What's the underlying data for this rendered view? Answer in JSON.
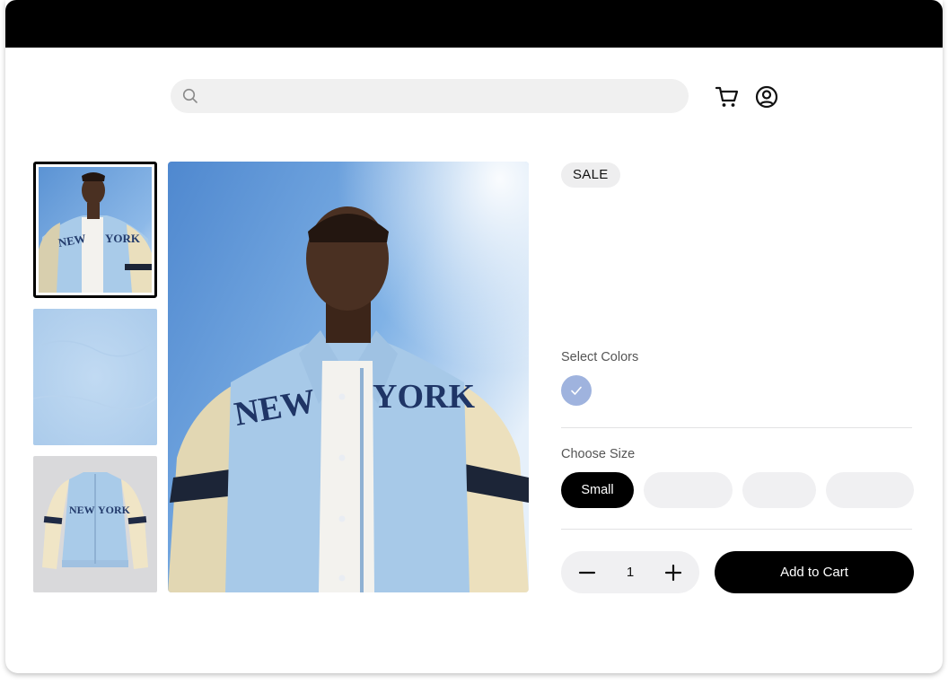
{
  "header": {
    "search": {
      "placeholder": ""
    },
    "icons": [
      "search-icon",
      "cart-icon",
      "account-icon"
    ]
  },
  "gallery": {
    "thumbnails": [
      {
        "name": "model-wearing-jacket",
        "selected": true
      },
      {
        "name": "fabric-texture",
        "selected": false
      },
      {
        "name": "jacket-flat",
        "selected": false
      }
    ],
    "jacket_lettering_left": "NEW",
    "jacket_lettering_right": "YORK"
  },
  "product": {
    "badge": "SALE",
    "colors_label": "Select Colors",
    "colors": [
      {
        "hex": "#9fb3de",
        "selected": true
      }
    ],
    "size_label": "Choose Size",
    "sizes": [
      {
        "label": "Small",
        "selected": true
      },
      {
        "label": "",
        "selected": false
      },
      {
        "label": "",
        "selected": false
      },
      {
        "label": "",
        "selected": false
      }
    ],
    "quantity": "1",
    "add_to_cart_label": "Add to Cart"
  },
  "colors": {
    "accent": "#000000",
    "surface": "#f0f0f2",
    "swatch": "#9fb3de"
  }
}
